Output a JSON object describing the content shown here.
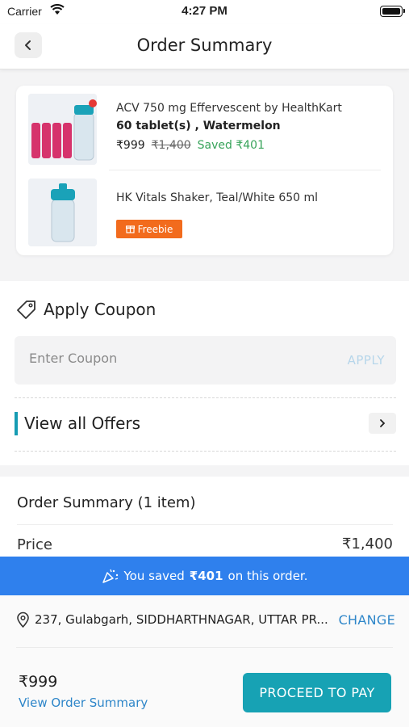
{
  "status_bar": {
    "carrier": "Carrier",
    "time": "4:27 PM"
  },
  "header": {
    "title": "Order Summary"
  },
  "products": [
    {
      "name": "ACV 750 mg Effervescent by HealthKart",
      "variant": "60 tablet(s) , Watermelon",
      "price": "₹999",
      "mrp": "₹1,400",
      "saved": "Saved ₹401"
    },
    {
      "name": "HK Vitals Shaker,  Teal/White  650 ml",
      "badge": "Freebie"
    }
  ],
  "coupon": {
    "title": "Apply Coupon",
    "placeholder": "Enter Coupon",
    "apply_label": "APPLY",
    "offers_label": "View all Offers"
  },
  "summary": {
    "heading": "Order Summary (1 item)",
    "price_label": "Price",
    "price_value": "₹1,400"
  },
  "savings_banner": {
    "prefix": "You saved",
    "amount": "₹401",
    "suffix": "on this order."
  },
  "address": {
    "text": "237, Gulabgarh, SIDDHARTHNAGAR, UTTAR PR...",
    "change_label": "CHANGE"
  },
  "footer": {
    "total": "₹999",
    "view_summary": "View Order Summary",
    "pay_label": "PROCEED TO PAY"
  },
  "colors": {
    "accent": "#17a2b4",
    "link": "#2e86c9",
    "banner": "#2f80ed",
    "freebie": "#f26b1d",
    "saved": "#37a35a"
  }
}
